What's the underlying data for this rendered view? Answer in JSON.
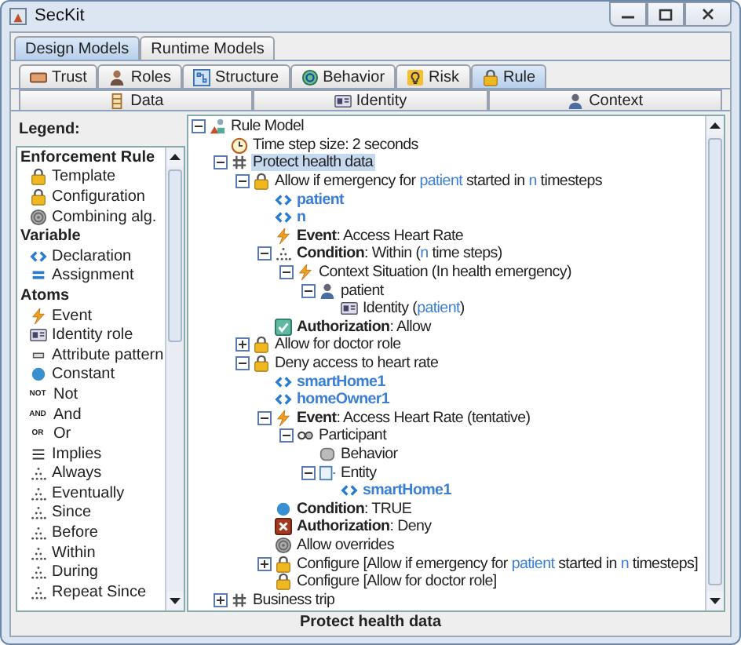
{
  "window": {
    "title": "SecKit"
  },
  "model_tabs": [
    {
      "label": "Design Models",
      "selected": true
    },
    {
      "label": "Runtime Models",
      "selected": false
    }
  ],
  "design_tabs": [
    {
      "label": "Trust",
      "kind": "trust",
      "selected": false
    },
    {
      "label": "Roles",
      "kind": "roles",
      "selected": false
    },
    {
      "label": "Structure",
      "kind": "structure",
      "selected": false
    },
    {
      "label": "Behavior",
      "kind": "behavior",
      "selected": false
    },
    {
      "label": "Risk",
      "kind": "risk",
      "selected": false
    },
    {
      "label": "Rule",
      "kind": "lock",
      "selected": true
    }
  ],
  "sub_tabs": [
    {
      "label": "Data",
      "kind": "data",
      "selected": false
    },
    {
      "label": "Identity",
      "kind": "identity",
      "selected": false
    },
    {
      "label": "Context",
      "kind": "person",
      "selected": false
    }
  ],
  "legend": {
    "title": "Legend:",
    "items": [
      {
        "kind": "heading",
        "label": "Enforcement Rule"
      },
      {
        "kind": "lock",
        "label": "Template"
      },
      {
        "kind": "lock",
        "label": "Configuration"
      },
      {
        "kind": "combining",
        "label": "Combining alg."
      },
      {
        "kind": "heading",
        "label": "Variable"
      },
      {
        "kind": "var",
        "label": "Declaration"
      },
      {
        "kind": "assign",
        "label": "Assignment"
      },
      {
        "kind": "heading",
        "label": "Atoms"
      },
      {
        "kind": "event",
        "label": "Event"
      },
      {
        "kind": "identity",
        "label": "Identity role"
      },
      {
        "kind": "attribute",
        "label": "Attribute pattern"
      },
      {
        "kind": "constant",
        "label": "Constant"
      },
      {
        "kind": "glyph",
        "glyph": "NOT",
        "label": "Not"
      },
      {
        "kind": "glyph",
        "glyph": "AND",
        "label": "And"
      },
      {
        "kind": "glyph",
        "glyph": "OR",
        "label": "Or"
      },
      {
        "kind": "implies",
        "label": "Implies"
      },
      {
        "kind": "temporal",
        "label": "Always"
      },
      {
        "kind": "temporal",
        "label": "Eventually"
      },
      {
        "kind": "temporal",
        "label": "Since"
      },
      {
        "kind": "temporal",
        "label": "Before"
      },
      {
        "kind": "temporal",
        "label": "Within"
      },
      {
        "kind": "temporal",
        "label": "During"
      },
      {
        "kind": "temporal",
        "label": "Repeat Since"
      }
    ]
  },
  "tree": [
    {
      "kind": "model",
      "expanded": true,
      "selected": false,
      "parts": [
        {
          "kind": "text",
          "text": "Rule Model"
        }
      ],
      "children": [
        {
          "kind": "clock",
          "selected": false,
          "parts": [
            {
              "kind": "text",
              "text": "Time step size: 2 seconds"
            }
          ]
        },
        {
          "kind": "group",
          "expanded": true,
          "selected": true,
          "parts": [
            {
              "kind": "text",
              "text": "Protect health data"
            }
          ],
          "children": [
            {
              "kind": "lock",
              "expanded": true,
              "selected": false,
              "parts": [
                {
                  "kind": "text",
                  "text": "Allow if emergency for "
                },
                {
                  "kind": "variable",
                  "text": "patient"
                },
                {
                  "kind": "text",
                  "text": " started in "
                },
                {
                  "kind": "variable",
                  "text": "n"
                },
                {
                  "kind": "text",
                  "text": " timesteps"
                }
              ],
              "children": [
                {
                  "kind": "var",
                  "selected": false,
                  "parts": [
                    {
                      "kind": "text",
                      "text": "patient"
                    }
                  ]
                },
                {
                  "kind": "var",
                  "selected": false,
                  "parts": [
                    {
                      "kind": "text",
                      "text": "n"
                    }
                  ]
                },
                {
                  "kind": "event",
                  "selected": false,
                  "parts": [
                    {
                      "kind": "text",
                      "text": "**Event**: Access Heart Rate"
                    }
                  ]
                },
                {
                  "kind": "temporal",
                  "expanded": true,
                  "selected": false,
                  "parts": [
                    {
                      "kind": "text",
                      "text": "**Condition**: Within ("
                    },
                    {
                      "kind": "variable",
                      "text": "n"
                    },
                    {
                      "kind": "text",
                      "text": " time steps)"
                    }
                  ],
                  "children": [
                    {
                      "kind": "event",
                      "expanded": true,
                      "selected": false,
                      "parts": [
                        {
                          "kind": "text",
                          "text": "Context Situation (In health emergency)"
                        }
                      ],
                      "children": [
                        {
                          "kind": "person",
                          "expanded": true,
                          "selected": false,
                          "parts": [
                            {
                              "kind": "text",
                              "text": "patient"
                            }
                          ],
                          "children": [
                            {
                              "kind": "identity",
                              "selected": false,
                              "parts": [
                                {
                                  "kind": "text",
                                  "text": "Identity ("
                                },
                                {
                                  "kind": "variable",
                                  "text": "patient"
                                },
                                {
                                  "kind": "text",
                                  "text": ")"
                                }
                              ]
                            }
                          ]
                        }
                      ]
                    }
                  ]
                },
                {
                  "kind": "allow",
                  "selected": false,
                  "parts": [
                    {
                      "kind": "text",
                      "text": "**Authorization**: Allow"
                    }
                  ]
                }
              ]
            },
            {
              "kind": "lock",
              "expanded": false,
              "selected": false,
              "parts": [
                {
                  "kind": "text",
                  "text": "Allow for doctor role"
                }
              ]
            },
            {
              "kind": "lock",
              "expanded": true,
              "selected": false,
              "parts": [
                {
                  "kind": "text",
                  "text": "Deny access to heart rate"
                }
              ],
              "children": [
                {
                  "kind": "var",
                  "selected": false,
                  "parts": [
                    {
                      "kind": "text",
                      "text": "smartHome1"
                    }
                  ]
                },
                {
                  "kind": "var",
                  "selected": false,
                  "parts": [
                    {
                      "kind": "text",
                      "text": "homeOwner1"
                    }
                  ]
                },
                {
                  "kind": "event",
                  "expanded": true,
                  "selected": false,
                  "parts": [
                    {
                      "kind": "text",
                      "text": "**Event**: Access Heart Rate (tentative)"
                    }
                  ],
                  "children": [
                    {
                      "kind": "participant",
                      "expanded": true,
                      "selected": false,
                      "parts": [
                        {
                          "kind": "text",
                          "text": "Participant"
                        }
                      ],
                      "children": [
                        {
                          "kind": "behavior",
                          "selected": false,
                          "parts": [
                            {
                              "kind": "text",
                              "text": "Behavior"
                            }
                          ]
                        },
                        {
                          "kind": "entity",
                          "expanded": true,
                          "selected": false,
                          "parts": [
                            {
                              "kind": "text",
                              "text": "Entity"
                            }
                          ],
                          "children": [
                            {
                              "kind": "var",
                              "selected": false,
                              "parts": [
                                {
                                  "kind": "text",
                                  "text": "smartHome1"
                                }
                              ]
                            }
                          ]
                        }
                      ]
                    }
                  ]
                },
                {
                  "kind": "constant",
                  "selected": false,
                  "parts": [
                    {
                      "kind": "text",
                      "text": "**Condition**: TRUE"
                    }
                  ]
                },
                {
                  "kind": "deny",
                  "selected": false,
                  "parts": [
                    {
                      "kind": "text",
                      "text": "**Authorization**: Deny"
                    }
                  ]
                },
                {
                  "kind": "combining",
                  "selected": false,
                  "parts": [
                    {
                      "kind": "text",
                      "text": "Allow overrides"
                    }
                  ]
                },
                {
                  "kind": "lock",
                  "expanded": false,
                  "selected": false,
                  "parts": [
                    {
                      "kind": "text",
                      "text": "Configure [Allow if emergency for "
                    },
                    {
                      "kind": "variable",
                      "text": "patient"
                    },
                    {
                      "kind": "text",
                      "text": " started in "
                    },
                    {
                      "kind": "variable",
                      "text": "n"
                    },
                    {
                      "kind": "text",
                      "text": " timesteps]"
                    }
                  ]
                },
                {
                  "kind": "lock",
                  "selected": false,
                  "parts": [
                    {
                      "kind": "text",
                      "text": "Configure [Allow for doctor role]"
                    }
                  ]
                }
              ]
            }
          ]
        },
        {
          "kind": "group",
          "expanded": false,
          "selected": false,
          "parts": [
            {
              "kind": "text",
              "text": "Business trip"
            }
          ]
        }
      ]
    }
  ],
  "status_bar": {
    "text": "Protect health data"
  }
}
